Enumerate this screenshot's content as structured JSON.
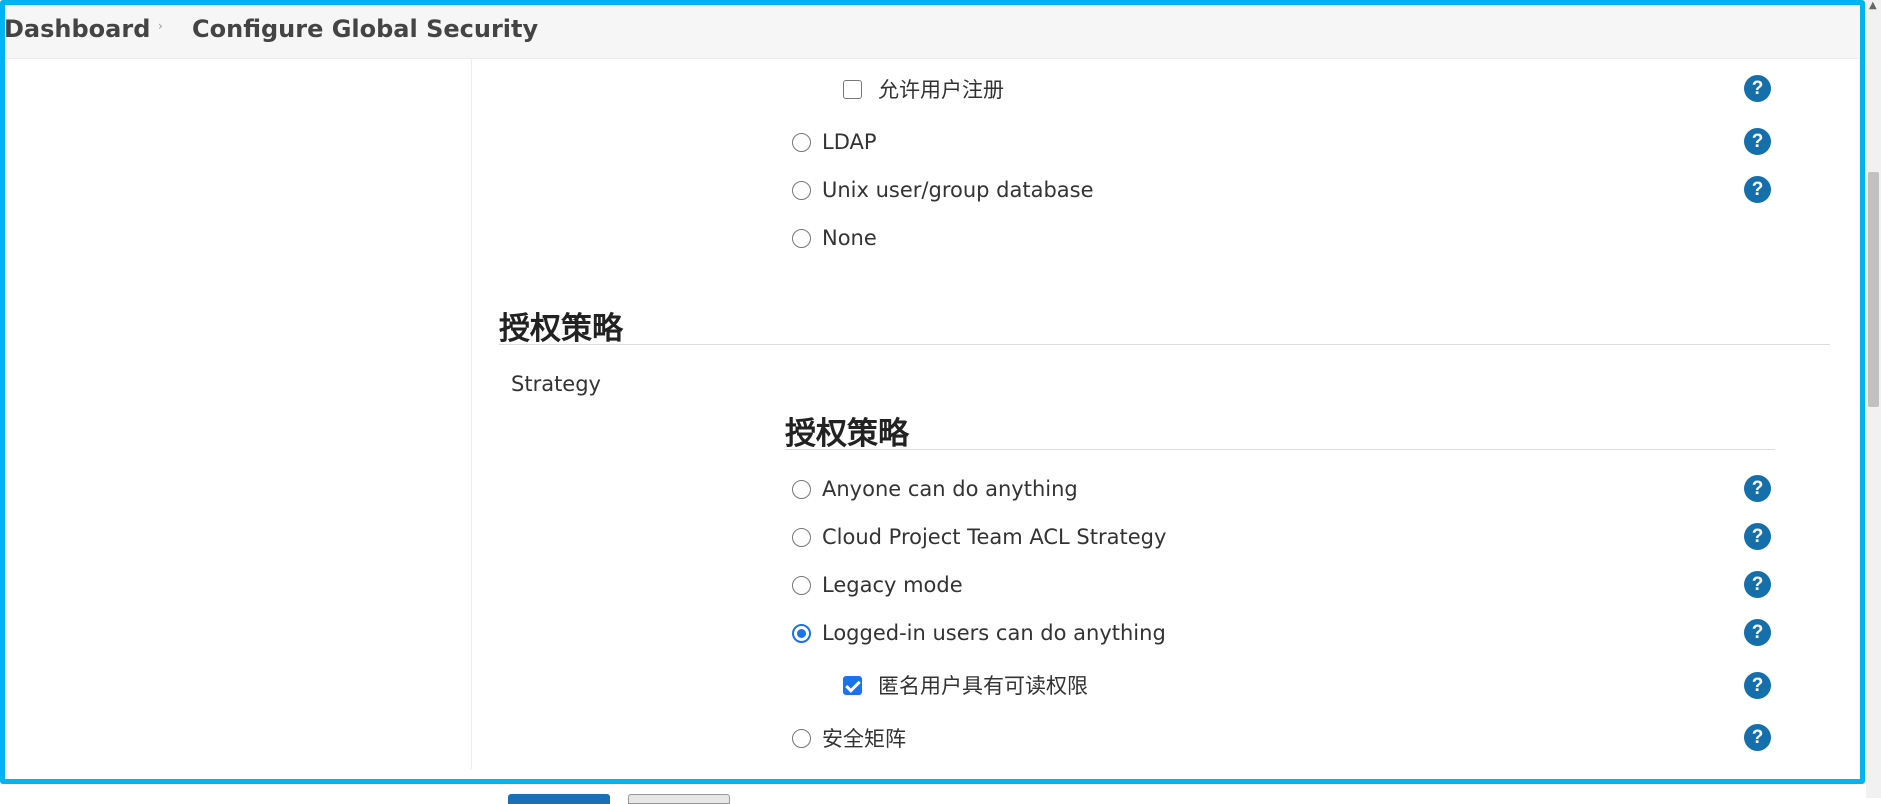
{
  "breadcrumb": {
    "root": "Dashboard",
    "separator": "›",
    "current": "Configure Global Security"
  },
  "security_realm": {
    "allow_signup": {
      "label": "允许用户注册",
      "checked": false
    },
    "options": [
      {
        "label": "LDAP",
        "selected": false
      },
      {
        "label": "Unix user/group database",
        "selected": false
      },
      {
        "label": "None",
        "selected": false
      }
    ]
  },
  "authorization": {
    "section_title": "授权策略",
    "strategy_label": "Strategy",
    "inner_title": "授权策略",
    "options": [
      {
        "label": "Anyone can do anything",
        "selected": false
      },
      {
        "label": "Cloud Project Team ACL Strategy",
        "selected": false
      },
      {
        "label": "Legacy mode",
        "selected": false
      },
      {
        "label": "Logged-in users can do anything",
        "selected": true
      },
      {
        "label": "安全矩阵",
        "selected": false
      }
    ],
    "anonymous_read": {
      "label": "匿名用户具有可读权限",
      "checked": true
    }
  },
  "help_icon": {
    "glyph": "?",
    "color": "#146fab"
  },
  "colors": {
    "frame": "#00b4f0",
    "selected": "#1a73e8"
  }
}
